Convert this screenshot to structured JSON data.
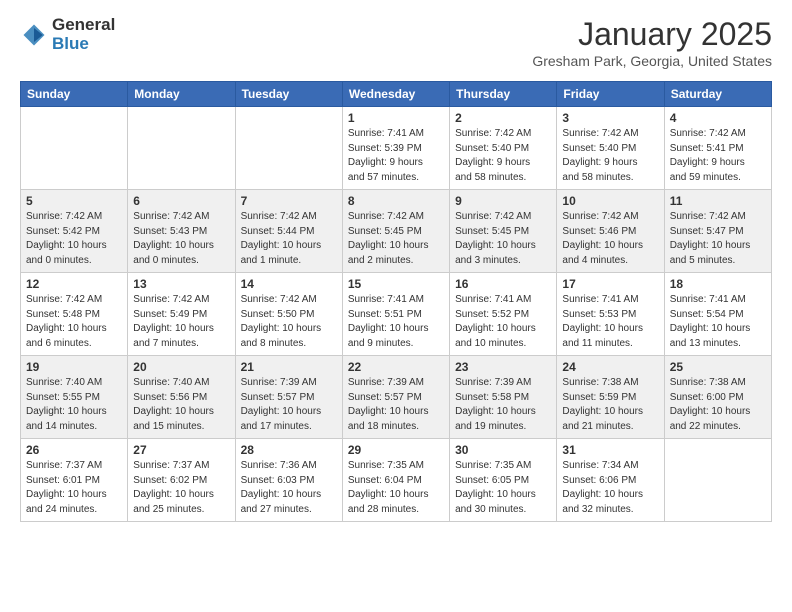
{
  "header": {
    "logo_general": "General",
    "logo_blue": "Blue",
    "month_title": "January 2025",
    "location": "Gresham Park, Georgia, United States"
  },
  "days_of_week": [
    "Sunday",
    "Monday",
    "Tuesday",
    "Wednesday",
    "Thursday",
    "Friday",
    "Saturday"
  ],
  "weeks": [
    {
      "shaded": false,
      "days": [
        {
          "num": "",
          "info": ""
        },
        {
          "num": "",
          "info": ""
        },
        {
          "num": "",
          "info": ""
        },
        {
          "num": "1",
          "info": "Sunrise: 7:41 AM\nSunset: 5:39 PM\nDaylight: 9 hours\nand 57 minutes."
        },
        {
          "num": "2",
          "info": "Sunrise: 7:42 AM\nSunset: 5:40 PM\nDaylight: 9 hours\nand 58 minutes."
        },
        {
          "num": "3",
          "info": "Sunrise: 7:42 AM\nSunset: 5:40 PM\nDaylight: 9 hours\nand 58 minutes."
        },
        {
          "num": "4",
          "info": "Sunrise: 7:42 AM\nSunset: 5:41 PM\nDaylight: 9 hours\nand 59 minutes."
        }
      ]
    },
    {
      "shaded": true,
      "days": [
        {
          "num": "5",
          "info": "Sunrise: 7:42 AM\nSunset: 5:42 PM\nDaylight: 10 hours\nand 0 minutes."
        },
        {
          "num": "6",
          "info": "Sunrise: 7:42 AM\nSunset: 5:43 PM\nDaylight: 10 hours\nand 0 minutes."
        },
        {
          "num": "7",
          "info": "Sunrise: 7:42 AM\nSunset: 5:44 PM\nDaylight: 10 hours\nand 1 minute."
        },
        {
          "num": "8",
          "info": "Sunrise: 7:42 AM\nSunset: 5:45 PM\nDaylight: 10 hours\nand 2 minutes."
        },
        {
          "num": "9",
          "info": "Sunrise: 7:42 AM\nSunset: 5:45 PM\nDaylight: 10 hours\nand 3 minutes."
        },
        {
          "num": "10",
          "info": "Sunrise: 7:42 AM\nSunset: 5:46 PM\nDaylight: 10 hours\nand 4 minutes."
        },
        {
          "num": "11",
          "info": "Sunrise: 7:42 AM\nSunset: 5:47 PM\nDaylight: 10 hours\nand 5 minutes."
        }
      ]
    },
    {
      "shaded": false,
      "days": [
        {
          "num": "12",
          "info": "Sunrise: 7:42 AM\nSunset: 5:48 PM\nDaylight: 10 hours\nand 6 minutes."
        },
        {
          "num": "13",
          "info": "Sunrise: 7:42 AM\nSunset: 5:49 PM\nDaylight: 10 hours\nand 7 minutes."
        },
        {
          "num": "14",
          "info": "Sunrise: 7:42 AM\nSunset: 5:50 PM\nDaylight: 10 hours\nand 8 minutes."
        },
        {
          "num": "15",
          "info": "Sunrise: 7:41 AM\nSunset: 5:51 PM\nDaylight: 10 hours\nand 9 minutes."
        },
        {
          "num": "16",
          "info": "Sunrise: 7:41 AM\nSunset: 5:52 PM\nDaylight: 10 hours\nand 10 minutes."
        },
        {
          "num": "17",
          "info": "Sunrise: 7:41 AM\nSunset: 5:53 PM\nDaylight: 10 hours\nand 11 minutes."
        },
        {
          "num": "18",
          "info": "Sunrise: 7:41 AM\nSunset: 5:54 PM\nDaylight: 10 hours\nand 13 minutes."
        }
      ]
    },
    {
      "shaded": true,
      "days": [
        {
          "num": "19",
          "info": "Sunrise: 7:40 AM\nSunset: 5:55 PM\nDaylight: 10 hours\nand 14 minutes."
        },
        {
          "num": "20",
          "info": "Sunrise: 7:40 AM\nSunset: 5:56 PM\nDaylight: 10 hours\nand 15 minutes."
        },
        {
          "num": "21",
          "info": "Sunrise: 7:39 AM\nSunset: 5:57 PM\nDaylight: 10 hours\nand 17 minutes."
        },
        {
          "num": "22",
          "info": "Sunrise: 7:39 AM\nSunset: 5:57 PM\nDaylight: 10 hours\nand 18 minutes."
        },
        {
          "num": "23",
          "info": "Sunrise: 7:39 AM\nSunset: 5:58 PM\nDaylight: 10 hours\nand 19 minutes."
        },
        {
          "num": "24",
          "info": "Sunrise: 7:38 AM\nSunset: 5:59 PM\nDaylight: 10 hours\nand 21 minutes."
        },
        {
          "num": "25",
          "info": "Sunrise: 7:38 AM\nSunset: 6:00 PM\nDaylight: 10 hours\nand 22 minutes."
        }
      ]
    },
    {
      "shaded": false,
      "days": [
        {
          "num": "26",
          "info": "Sunrise: 7:37 AM\nSunset: 6:01 PM\nDaylight: 10 hours\nand 24 minutes."
        },
        {
          "num": "27",
          "info": "Sunrise: 7:37 AM\nSunset: 6:02 PM\nDaylight: 10 hours\nand 25 minutes."
        },
        {
          "num": "28",
          "info": "Sunrise: 7:36 AM\nSunset: 6:03 PM\nDaylight: 10 hours\nand 27 minutes."
        },
        {
          "num": "29",
          "info": "Sunrise: 7:35 AM\nSunset: 6:04 PM\nDaylight: 10 hours\nand 28 minutes."
        },
        {
          "num": "30",
          "info": "Sunrise: 7:35 AM\nSunset: 6:05 PM\nDaylight: 10 hours\nand 30 minutes."
        },
        {
          "num": "31",
          "info": "Sunrise: 7:34 AM\nSunset: 6:06 PM\nDaylight: 10 hours\nand 32 minutes."
        },
        {
          "num": "",
          "info": ""
        }
      ]
    }
  ]
}
